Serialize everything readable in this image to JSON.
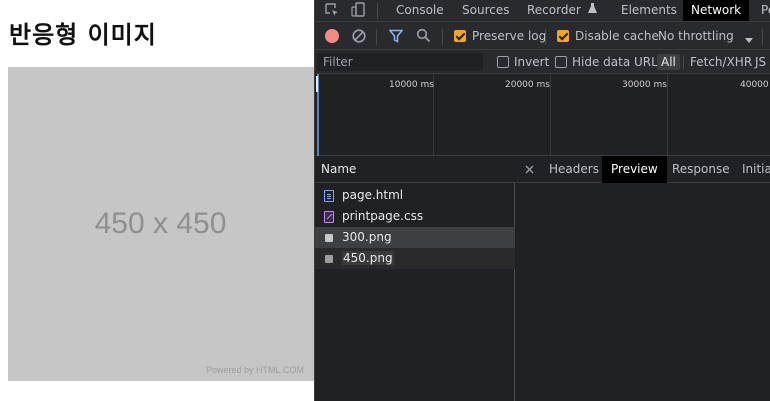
{
  "page": {
    "heading": "반응형 이미지",
    "image": {
      "size_text": "450 x 450",
      "credit_text": "Powered by HTML.COM"
    }
  },
  "devtools": {
    "tabs": [
      "Console",
      "Sources",
      "Recorder",
      "Elements",
      "Network",
      "Pe"
    ],
    "active_tab": "Network",
    "toolbar": {
      "preserve_log": {
        "label": "Preserve log",
        "checked": true
      },
      "disable_cache": {
        "label": "Disable cache",
        "checked": true
      },
      "throttling": "No throttling"
    },
    "filter": {
      "placeholder": "Filter",
      "invert": {
        "label": "Invert",
        "checked": false
      },
      "hide_data_urls": {
        "label": "Hide data URLs",
        "checked": false
      },
      "types": [
        "All",
        "Fetch/XHR",
        "JS"
      ]
    },
    "timeline": {
      "ticks": [
        "10000 ms",
        "20000 ms",
        "30000 ms",
        "40000"
      ]
    },
    "requests": {
      "column_name": "Name",
      "rows": [
        {
          "name": "page.html",
          "type": "document"
        },
        {
          "name": "printpage.css",
          "type": "stylesheet"
        },
        {
          "name": "300.png",
          "type": "image"
        },
        {
          "name": "450.png",
          "type": "image"
        }
      ]
    },
    "detail_tabs": [
      "Headers",
      "Preview",
      "Response",
      "Initiat"
    ],
    "active_detail_tab": "Preview",
    "colors": {
      "accent_checkbox": "#f5a623",
      "record_button": "#f28b82",
      "filter_icon": "#8ab4f8"
    }
  }
}
